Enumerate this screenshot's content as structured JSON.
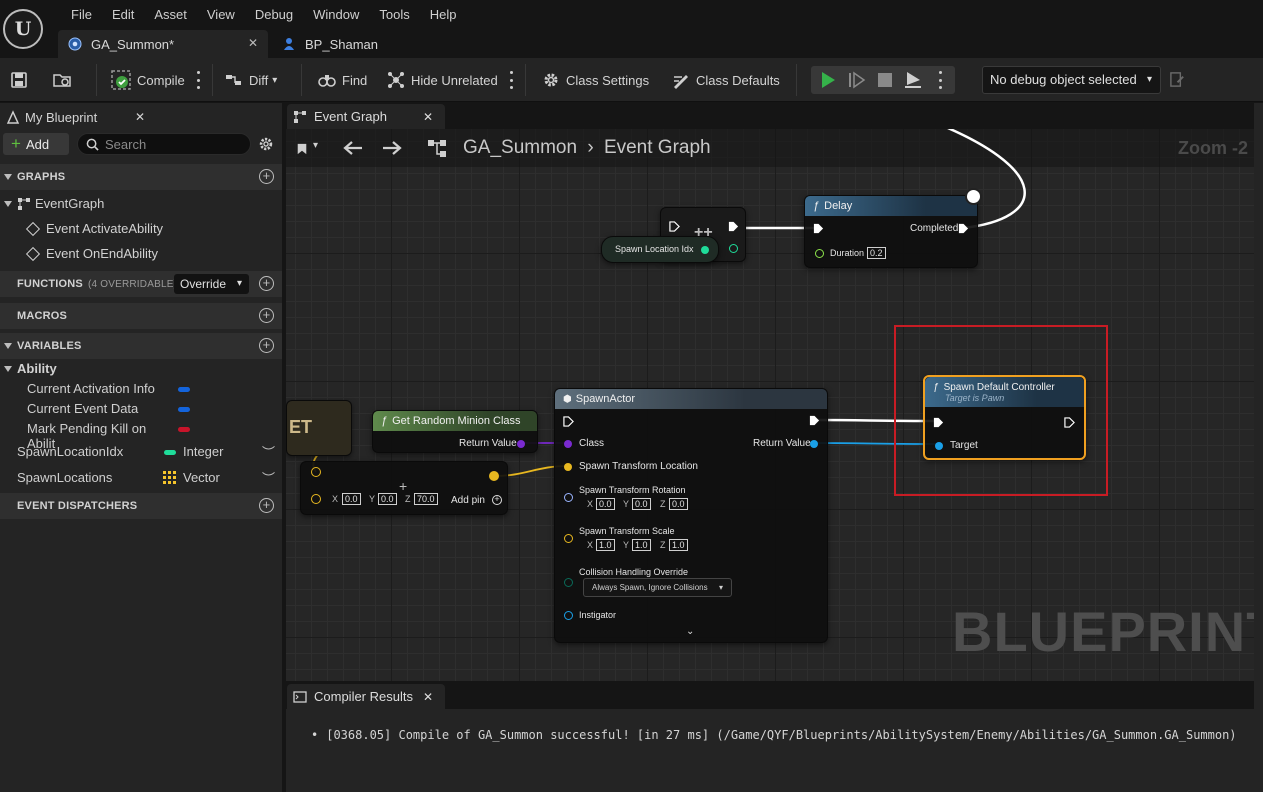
{
  "menu": [
    "File",
    "Edit",
    "Asset",
    "View",
    "Debug",
    "Window",
    "Tools",
    "Help"
  ],
  "doc_tabs": [
    {
      "label": "GA_Summon*",
      "icon": "asset-icon"
    },
    {
      "label": "BP_Shaman",
      "icon": "pawn-icon"
    }
  ],
  "toolbar": {
    "compile": "Compile",
    "diff": "Diff",
    "find": "Find",
    "hide_unrelated": "Hide Unrelated",
    "class_settings": "Class Settings",
    "class_defaults": "Class Defaults",
    "debug_object": "No debug object selected"
  },
  "my_blueprint": {
    "tab_label": "My Blueprint",
    "add_label": "Add",
    "search_placeholder": "Search",
    "graphs_header": "GRAPHS",
    "event_graph": "EventGraph",
    "events": [
      "Event ActivateAbility",
      "Event OnEndAbility"
    ],
    "functions_header": "FUNCTIONS",
    "functions_count": "(4 OVERRIDABLE)",
    "override_label": "Override",
    "macros_header": "MACROS",
    "variables_header": "VARIABLES",
    "ability_category": "Ability",
    "ability_vars": [
      {
        "name": "Current Activation Info",
        "color": "#1464dc"
      },
      {
        "name": "Current Event Data",
        "color": "#1464dc"
      },
      {
        "name": "Mark Pending Kill on Abilit",
        "color": "#c8142a"
      }
    ],
    "vars": [
      {
        "name": "SpawnLocationIdx",
        "type": "Integer",
        "color": "#1fdc9a"
      },
      {
        "name": "SpawnLocations",
        "type": "Vector",
        "color": "#f4c42c"
      }
    ],
    "dispatchers_header": "EVENT DISPATCHERS"
  },
  "graph": {
    "tab_label": "Event Graph",
    "breadcrumb_root": "GA_Summon",
    "breadcrumb_leaf": "Event Graph",
    "zoom": "Zoom -2",
    "watermark": "BLUEPRINT",
    "nodes": {
      "delay": {
        "title": "Delay",
        "completed": "Completed",
        "duration_label": "Duration",
        "duration_value": "0.2"
      },
      "spawn_location_idx": "Spawn Location Idx",
      "get_random": {
        "title": "Get Random Minion Class",
        "return_value": "Return Value"
      },
      "make_vector": {
        "x": "0.0",
        "y": "0.0",
        "z": "70.0",
        "add_pin": "Add pin"
      },
      "spawn_actor": {
        "title": "SpawnActor",
        "class": "Class",
        "return_value": "Return Value",
        "location": "Spawn Transform Location",
        "rotation": "Spawn Transform Rotation",
        "rot": {
          "x": "0.0",
          "y": "0.0",
          "z": "0.0"
        },
        "scale": "Spawn Transform Scale",
        "scl": {
          "x": "1.0",
          "y": "1.0",
          "z": "1.0"
        },
        "collision": "Collision Handling Override",
        "collision_value": "Always Spawn, Ignore Collisions",
        "instigator": "Instigator"
      },
      "spawn_default_controller": {
        "title": "Spawn Default Controller",
        "subtitle": "Target is Pawn",
        "target": "Target"
      },
      "partial_node_text": "ET"
    }
  },
  "compiler": {
    "tab_label": "Compiler Results",
    "line": "[0368.05] Compile of GA_Summon successful! [in 27 ms] (/Game/QYF/Blueprints/AbilitySystem/Enemy/Abilities/GA_Summon.GA_Summon)"
  }
}
